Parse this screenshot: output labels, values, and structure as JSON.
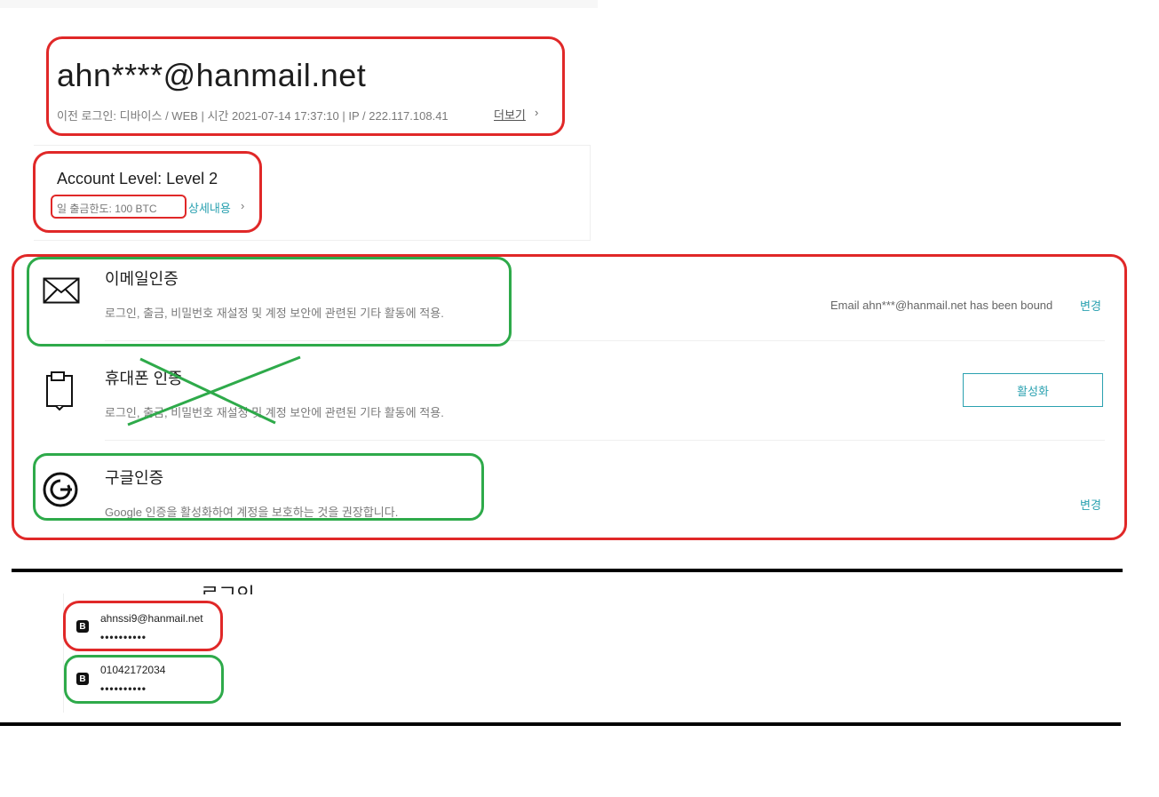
{
  "account": {
    "email": "ahn****@hanmail.net",
    "last_login": "이전 로그인: 디바이스 / WEB | 시간 2021-07-14 17:37:10 | IP / 222.117.108.41",
    "more_label": "더보기",
    "more_chevron": "›"
  },
  "level": {
    "title": "Account Level: Level 2",
    "limit": "일 출금한도: 100 BTC",
    "detail_label": "상세내용",
    "detail_chevron": "›"
  },
  "verifications": [
    {
      "icon": "envelope-icon",
      "title": "이메일인증",
      "desc": "로그인, 출금, 비밀번호 재설정 및 계정 보안에 관련된 기타 활동에 적용.",
      "status": "Email ahn***@hanmail.net has been bound",
      "action": "변경"
    },
    {
      "icon": "phone-icon",
      "title": "휴대폰 인증",
      "desc": "로그인, 출금, 비밀번호 재설정 및 계정 보안에 관련된 기타 활동에 적용.",
      "action": "활성화"
    },
    {
      "icon": "google-icon",
      "title": "구글인증",
      "desc": "Google 인증을 활성화하여 계정을 보호하는 것을 권장합니다.",
      "action": "변경"
    }
  ],
  "login_panel": {
    "heading": "로그인",
    "accounts": [
      {
        "icon": "app-logo-icon",
        "username": "ahnssi9@hanmail.net",
        "password": "••••••••••"
      },
      {
        "icon": "app-logo-icon",
        "username": "01042172034",
        "password": "••••••••••"
      }
    ]
  },
  "colors": {
    "accent": "#2aa1b0",
    "annotation_red": "#e02828",
    "annotation_green": "#2eaa4a",
    "text_primary": "#1d1d1d",
    "text_muted": "#7a7a7a"
  }
}
